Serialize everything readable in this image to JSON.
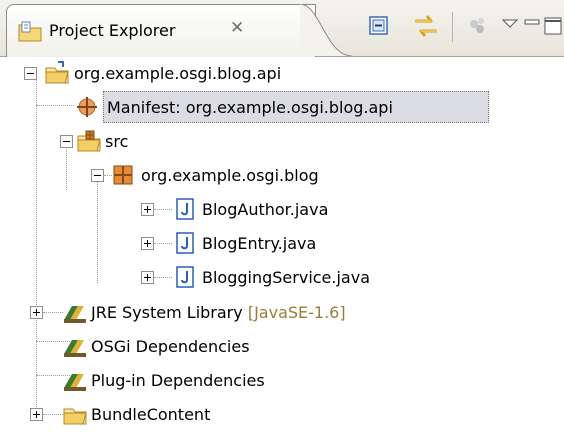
{
  "view": {
    "title": "Project Explorer",
    "close_glyph": "✕",
    "toolbar": {
      "collapse_all": "collapse-all-icon",
      "link_with_editor": "link-with-editor-icon",
      "customize": "filters-icon",
      "view_menu": "view-menu-icon",
      "minimize": "minimize-icon",
      "maximize": "maximize-icon"
    }
  },
  "tree": {
    "project": {
      "label": "org.example.osgi.blog.api"
    },
    "manifest": {
      "label": "Manifest: org.example.osgi.blog.api"
    },
    "src": {
      "label": "src"
    },
    "package": {
      "label": "org.example.osgi.blog"
    },
    "files": [
      {
        "label": "BlogAuthor.java"
      },
      {
        "label": "BlogEntry.java"
      },
      {
        "label": "BloggingService.java"
      }
    ],
    "jre": {
      "label": "JRE System Library",
      "decoration": "[JavaSE-1.6]"
    },
    "osgi_deps": {
      "label": "OSGi Dependencies"
    },
    "plugin_deps": {
      "label": "Plug-in Dependencies"
    },
    "bundle": {
      "label": "BundleContent"
    }
  },
  "colors": {
    "selection": "#dcdde3",
    "decoration": "#9a7d3a",
    "package_icon": "#c6792b",
    "java_icon": "#2b5fb4"
  }
}
